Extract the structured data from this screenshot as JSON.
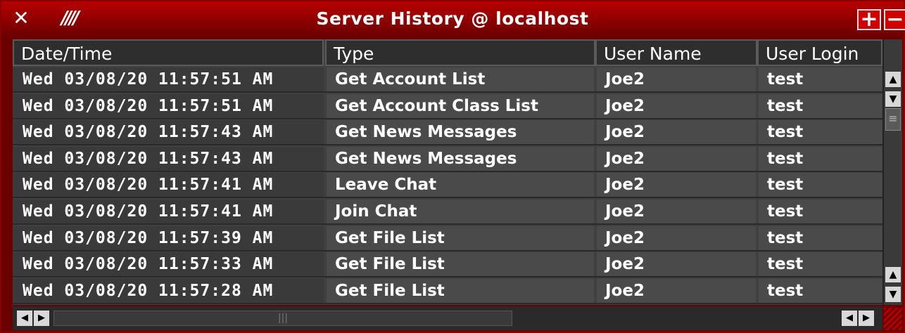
{
  "window": {
    "title": "Server History @ localhost",
    "close_glyph": "✕",
    "stripes_glyph": "////",
    "plus_glyph": "+",
    "minus_glyph": "−"
  },
  "columns": [
    "Date/Time",
    "Type",
    "User Name",
    "User Login"
  ],
  "rows": [
    {
      "date": "Wed 03/08/20 11:57:51 AM",
      "type": "Get Account List",
      "user": "Joe2",
      "login": "test"
    },
    {
      "date": "Wed 03/08/20 11:57:51 AM",
      "type": "Get Account Class List",
      "user": "Joe2",
      "login": "test"
    },
    {
      "date": "Wed 03/08/20 11:57:43 AM",
      "type": "Get News Messages",
      "user": "Joe2",
      "login": "test"
    },
    {
      "date": "Wed 03/08/20 11:57:43 AM",
      "type": "Get News Messages",
      "user": "Joe2",
      "login": "test"
    },
    {
      "date": "Wed 03/08/20 11:57:41 AM",
      "type": "Leave Chat",
      "user": "Joe2",
      "login": "test"
    },
    {
      "date": "Wed 03/08/20 11:57:41 AM",
      "type": "Join Chat",
      "user": "Joe2",
      "login": "test"
    },
    {
      "date": "Wed 03/08/20 11:57:39 AM",
      "type": "Get File List",
      "user": "Joe2",
      "login": "test"
    },
    {
      "date": "Wed 03/08/20 11:57:33 AM",
      "type": "Get File List",
      "user": "Joe2",
      "login": "test"
    },
    {
      "date": "Wed 03/08/20 11:57:28 AM",
      "type": "Get File List",
      "user": "Joe2",
      "login": "test"
    }
  ],
  "colors": {
    "accent": "#8a0000",
    "titlebar": "#b80000",
    "grid_bg": "#404040"
  }
}
